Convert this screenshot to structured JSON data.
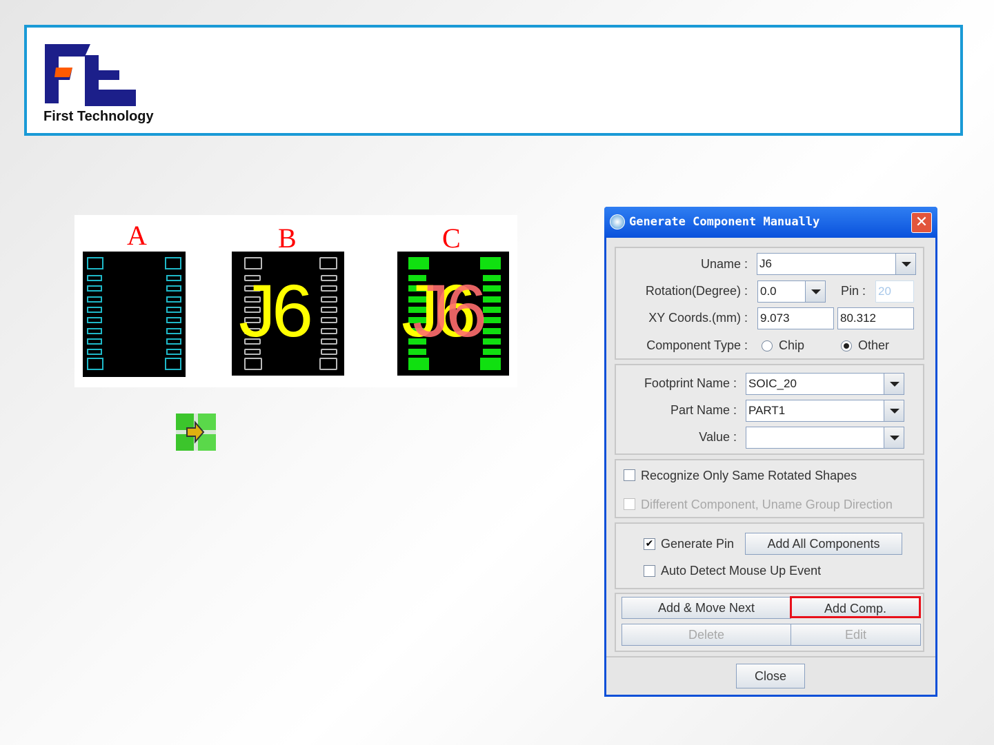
{
  "logo": {
    "company": "First Technology",
    "colors": {
      "navy": "#1c1f8a",
      "orange": "#ff5a00"
    }
  },
  "figure": {
    "labels": [
      "A",
      "B",
      "C"
    ],
    "silk_text": "J6",
    "pins_per_side": 10
  },
  "dialog": {
    "title": "Generate Component Manually",
    "uname_label": "Uname :",
    "uname_value": "J6",
    "rotation_label": "Rotation(Degree) :",
    "rotation_value": "0.0",
    "pin_label": "Pin :",
    "pin_value": "20",
    "xy_label": "XY Coords.(mm) :",
    "x_value": "9.073",
    "y_value": "80.312",
    "type_label": "Component Type :",
    "type_chip": "Chip",
    "type_other": "Other",
    "type_selected": "Other",
    "footprint_label": "Footprint Name :",
    "footprint_value": "SOIC_20",
    "part_label": "Part Name :",
    "part_value": "PART1",
    "value_label": "Value :",
    "value_value": "",
    "recognize_label": "Recognize Only Same Rotated Shapes",
    "different_label": "Different Component, Uname Group Direction",
    "generate_pin_label": "Generate Pin",
    "generate_pin_checked": true,
    "add_all_label": "Add All Components",
    "auto_detect_label": "Auto Detect Mouse Up Event",
    "add_move_next_label": "Add & Move Next",
    "add_comp_label": "Add Comp.",
    "delete_label": "Delete",
    "edit_label": "Edit",
    "close_label": "Close"
  }
}
